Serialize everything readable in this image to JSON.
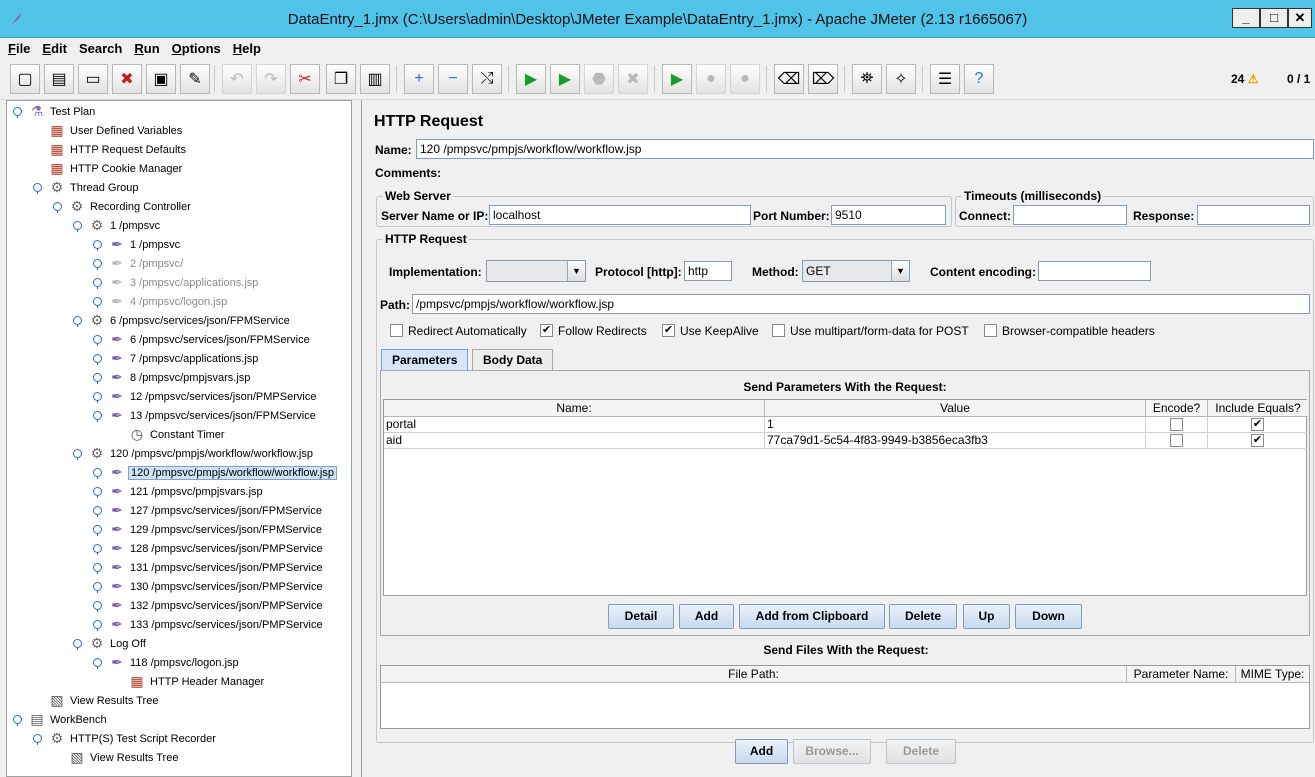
{
  "window": {
    "title": "DataEntry_1.jmx (C:\\Users\\admin\\Desktop\\JMeter Example\\DataEntry_1.jmx) - Apache JMeter (2.13 r1665067)",
    "minimize": "_",
    "maximize": "□",
    "close": "✕"
  },
  "menu": [
    {
      "mnemonic": "F",
      "rest": "ile"
    },
    {
      "mnemonic": "E",
      "rest": "dit"
    },
    {
      "mnemonic": "",
      "rest": "Search"
    },
    {
      "mnemonic": "R",
      "rest": "un"
    },
    {
      "mnemonic": "O",
      "rest": "ptions"
    },
    {
      "mnemonic": "H",
      "rest": "elp"
    }
  ],
  "toolbar": {
    "icons": [
      "new-icon",
      "templates-icon",
      "open-icon",
      "close-icon",
      "save-icon",
      "save-as-icon",
      "undo-icon",
      "redo-icon",
      "cut-icon",
      "copy-icon",
      "paste-icon",
      "expand-icon",
      "collapse-icon",
      "toggle-icon",
      "start-icon",
      "start-no-pauses-icon",
      "stop-icon",
      "shutdown-icon",
      "remote-start-icon",
      "remote-stop-icon",
      "remote-shutdown-icon",
      "clear-icon",
      "clear-all-icon",
      "search-icon",
      "reset-search-icon",
      "function-helper-icon",
      "help-icon"
    ],
    "glyphs": [
      "▢",
      "▤",
      "▭",
      "✖",
      "▣",
      "✎",
      "↶",
      "↷",
      "✂",
      "❐",
      "▥",
      "+",
      "−",
      "⤭",
      "▶",
      "▶",
      "⬣",
      "✖",
      "▶",
      "●",
      "●",
      "⌫",
      "⌦",
      "⛯",
      "✧",
      "☰",
      "?"
    ],
    "warning_count": "24",
    "warning_glyph": "⚠",
    "threads": "0 / 1"
  },
  "tree": [
    {
      "label": "Test Plan",
      "icon": "test-plan-icon",
      "glyph": "⚗",
      "color": "#8a6fc0"
    },
    {
      "label": "User Defined Variables",
      "icon": "config-element-icon",
      "glyph": "▦",
      "color": "#b0402c"
    },
    {
      "label": "HTTP Request Defaults",
      "icon": "config-element-icon",
      "glyph": "▦",
      "color": "#b0402c"
    },
    {
      "label": "HTTP Cookie Manager",
      "icon": "config-element-icon",
      "glyph": "▦",
      "color": "#b0402c"
    },
    {
      "label": "Thread Group",
      "icon": "thread-group-icon",
      "glyph": "⚙",
      "color": "#666"
    },
    {
      "label": "Recording Controller",
      "icon": "controller-icon",
      "glyph": "⚙",
      "color": "#666"
    },
    {
      "label": "1 /pmpsvc",
      "icon": "controller-icon",
      "glyph": "⚙",
      "color": "#666"
    },
    {
      "label": "1 /pmpsvc",
      "icon": "sampler-icon",
      "glyph": "✒",
      "color": "#7a5aa8"
    },
    {
      "label": "2 /pmpsvc/",
      "icon": "sampler-icon",
      "glyph": "✒",
      "color": "#b5b5b5"
    },
    {
      "label": "3 /pmpsvc/applications.jsp",
      "icon": "sampler-icon",
      "glyph": "✒",
      "color": "#b5b5b5"
    },
    {
      "label": "4 /pmpsvc/logon.jsp",
      "icon": "sampler-icon",
      "glyph": "✒",
      "color": "#b5b5b5"
    },
    {
      "label": "6 /pmpsvc/services/json/FPMService",
      "icon": "controller-icon",
      "glyph": "⚙",
      "color": "#666"
    },
    {
      "label": "6 /pmpsvc/services/json/FPMService",
      "icon": "sampler-icon",
      "glyph": "✒",
      "color": "#7a5aa8"
    },
    {
      "label": "7 /pmpsvc/applications.jsp",
      "icon": "sampler-icon",
      "glyph": "✒",
      "color": "#7a5aa8"
    },
    {
      "label": "8 /pmpsvc/pmpjsvars.jsp",
      "icon": "sampler-icon",
      "glyph": "✒",
      "color": "#7a5aa8"
    },
    {
      "label": "12 /pmpsvc/services/json/PMPService",
      "icon": "sampler-icon",
      "glyph": "✒",
      "color": "#7a5aa8"
    },
    {
      "label": "13 /pmpsvc/services/json/FPMService",
      "icon": "sampler-icon",
      "glyph": "✒",
      "color": "#7a5aa8"
    },
    {
      "label": "Constant Timer",
      "icon": "timer-icon",
      "glyph": "◷",
      "color": "#555"
    },
    {
      "label": "120 /pmpsvc/pmpjs/workflow/workflow.jsp",
      "icon": "controller-icon",
      "glyph": "⚙",
      "color": "#666"
    },
    {
      "label": "120 /pmpsvc/pmpjs/workflow/workflow.jsp",
      "icon": "sampler-icon",
      "glyph": "✒",
      "color": "#7a5aa8"
    },
    {
      "label": "121 /pmpsvc/pmpjsvars.jsp",
      "icon": "sampler-icon",
      "glyph": "✒",
      "color": "#7a5aa8"
    },
    {
      "label": "127 /pmpsvc/services/json/FPMService",
      "icon": "sampler-icon",
      "glyph": "✒",
      "color": "#7a5aa8"
    },
    {
      "label": "129 /pmpsvc/services/json/FPMService",
      "icon": "sampler-icon",
      "glyph": "✒",
      "color": "#7a5aa8"
    },
    {
      "label": "128 /pmpsvc/services/json/PMPService",
      "icon": "sampler-icon",
      "glyph": "✒",
      "color": "#7a5aa8"
    },
    {
      "label": "131 /pmpsvc/services/json/PMPService",
      "icon": "sampler-icon",
      "glyph": "✒",
      "color": "#7a5aa8"
    },
    {
      "label": "130 /pmpsvc/services/json/PMPService",
      "icon": "sampler-icon",
      "glyph": "✒",
      "color": "#7a5aa8"
    },
    {
      "label": "132 /pmpsvc/services/json/PMPService",
      "icon": "sampler-icon",
      "glyph": "✒",
      "color": "#7a5aa8"
    },
    {
      "label": "133 /pmpsvc/services/json/PMPService",
      "icon": "sampler-icon",
      "glyph": "✒",
      "color": "#7a5aa8"
    },
    {
      "label": "Log Off",
      "icon": "controller-icon",
      "glyph": "⚙",
      "color": "#666"
    },
    {
      "label": "118 /pmpsvc/logon.jsp",
      "icon": "sampler-icon",
      "glyph": "✒",
      "color": "#7a5aa8"
    },
    {
      "label": "HTTP Header Manager",
      "icon": "config-element-icon",
      "glyph": "▦",
      "color": "#b0402c"
    },
    {
      "label": "View Results Tree",
      "icon": "listener-icon",
      "glyph": "▧",
      "color": "#555"
    },
    {
      "label": "WorkBench",
      "icon": "workbench-icon",
      "glyph": "▤",
      "color": "#555"
    },
    {
      "label": "HTTP(S) Test Script Recorder",
      "icon": "controller-icon",
      "glyph": "⚙",
      "color": "#666"
    },
    {
      "label": "View Results Tree",
      "icon": "listener-icon",
      "glyph": "▧",
      "color": "#555"
    }
  ],
  "panel": {
    "title": "HTTP Request",
    "name_label": "Name:",
    "name_value": "120 /pmpsvc/pmpjs/workflow/workflow.jsp",
    "comments_label": "Comments:",
    "web_server": {
      "legend": "Web Server",
      "server_label": "Server Name or IP:",
      "server_value": "localhost",
      "port_label": "Port Number:",
      "port_value": "9510"
    },
    "timeouts": {
      "legend": "Timeouts (milliseconds)",
      "connect_label": "Connect:",
      "connect_value": "",
      "response_label": "Response:",
      "response_value": ""
    },
    "http_request": {
      "legend": "HTTP Request",
      "impl_label": "Implementation:",
      "impl_value": "",
      "protocol_label": "Protocol [http]:",
      "protocol_value": "http",
      "method_label": "Method:",
      "method_value": "GET",
      "encoding_label": "Content encoding:",
      "encoding_value": "",
      "path_label": "Path:",
      "path_value": "/pmpsvc/pmpjs/workflow/workflow.jsp",
      "checkboxes": [
        {
          "label": "Redirect Automatically",
          "checked": false
        },
        {
          "label": "Follow Redirects",
          "checked": true
        },
        {
          "label": "Use KeepAlive",
          "checked": true
        },
        {
          "label": "Use multipart/form-data for POST",
          "checked": false
        },
        {
          "label": "Browser-compatible headers",
          "checked": false
        }
      ]
    },
    "tabs": [
      {
        "label": "Parameters",
        "active": true
      },
      {
        "label": "Body Data",
        "active": false
      }
    ],
    "params": {
      "title": "Send Parameters With the Request:",
      "columns": [
        "Name:",
        "Value",
        "Encode?",
        "Include Equals?"
      ],
      "rows": [
        {
          "name": "portal",
          "value": "1",
          "encode": false,
          "include_equals": true
        },
        {
          "name": "aid",
          "value": "77ca79d1-5c54-4f83-9949-b3856eca3fb3",
          "encode": false,
          "include_equals": true
        }
      ],
      "buttons": [
        "Detail",
        "Add",
        "Add from Clipboard",
        "Delete",
        "Up",
        "Down"
      ]
    },
    "files": {
      "title": "Send Files With the Request:",
      "columns": [
        "File Path:",
        "Parameter Name:",
        "MIME Type:"
      ],
      "buttons": [
        {
          "label": "Add",
          "enabled": true
        },
        {
          "label": "Browse...",
          "enabled": false
        },
        {
          "label": "Delete",
          "enabled": false
        }
      ]
    },
    "check_glyph": "✔"
  }
}
